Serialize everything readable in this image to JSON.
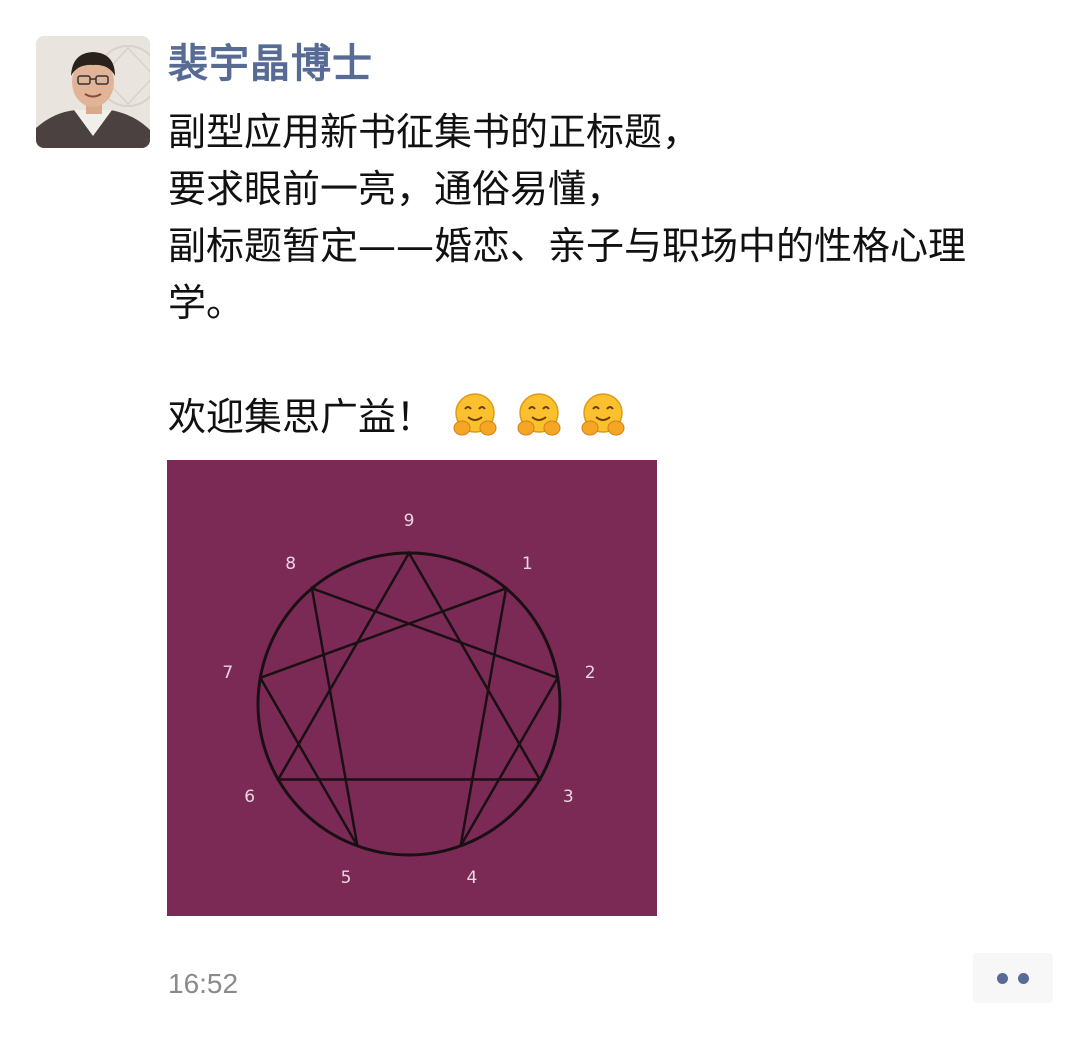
{
  "author": {
    "name": "裴宇晶博士"
  },
  "post": {
    "lines": [
      "副型应用新书征集书的正标题，",
      "要求眼前一亮，通俗易懂，",
      "副标题暂定——婚恋、亲子与职场中的性格心理",
      "学。"
    ],
    "welcome": "欢迎集思广益！",
    "emojis": [
      "hugging-face-icon",
      "hugging-face-icon",
      "hugging-face-icon"
    ]
  },
  "image": {
    "subject": "enneagram",
    "numbers": [
      "9",
      "1",
      "2",
      "3",
      "4",
      "5",
      "6",
      "7",
      "8"
    ],
    "background_color": "#7a2a55",
    "line_color": "#1a1014",
    "label_color": "#e8d6df"
  },
  "footer": {
    "time": "16:52",
    "more_icon": "more-dots-icon"
  },
  "colors": {
    "author_name": "#576b95",
    "body_text": "#111111",
    "timestamp": "#8a8a8a"
  }
}
